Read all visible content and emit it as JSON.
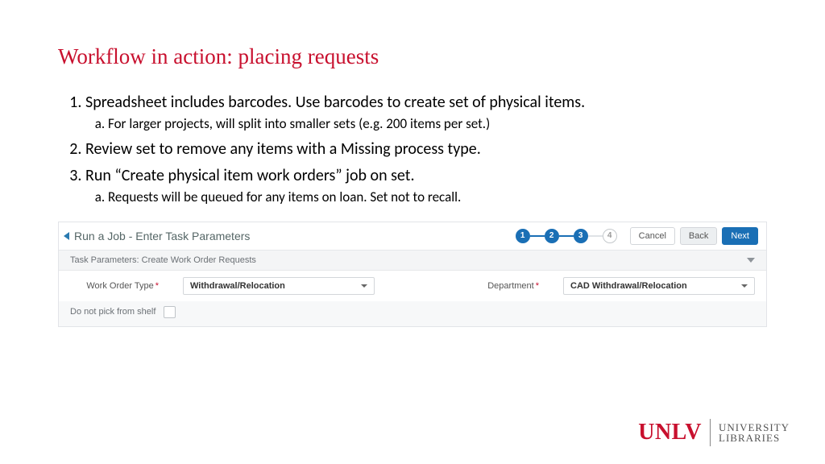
{
  "title": "Workflow in action: placing requests",
  "list": {
    "i1": "Spreadsheet includes barcodes. Use barcodes to create set of physical items.",
    "i1a": "For larger projects, will split into smaller sets (e.g. 200 items per set.)",
    "i2": "Review set to remove any items with a Missing process type.",
    "i3": "Run “Create physical item work orders” job on set.",
    "i3a": "Requests will be queued for any items on loan. Set not to recall."
  },
  "app": {
    "header_title": "Run a Job - Enter Task Parameters",
    "steps": {
      "s1": "1",
      "s2": "2",
      "s3": "3",
      "s4": "4"
    },
    "buttons": {
      "cancel": "Cancel",
      "back": "Back",
      "next": "Next"
    },
    "panel_title": "Task Parameters: Create Work Order Requests",
    "work_order_type_label": "Work Order Type",
    "work_order_type_value": "Withdrawal/Relocation",
    "department_label": "Department",
    "department_value": "CAD Withdrawal/Relocation",
    "do_not_pick_label": "Do not pick from shelf"
  },
  "logo": {
    "unlv": "UNLV",
    "top": "UNIVERSITY",
    "bottom": "LIBRARIES"
  }
}
